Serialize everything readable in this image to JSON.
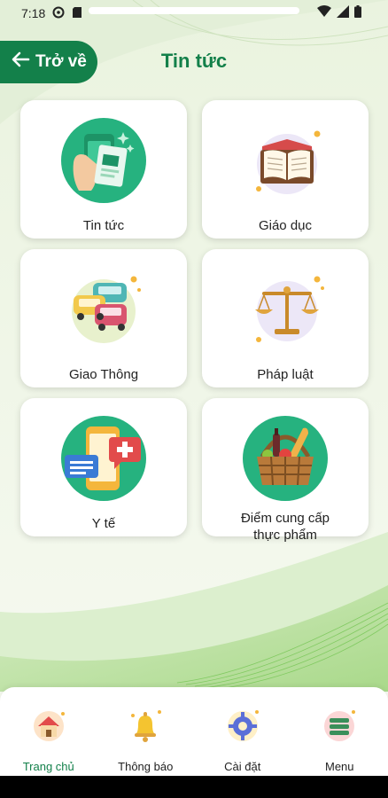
{
  "status_bar": {
    "time": "7:18"
  },
  "header": {
    "back_label": "Trở về",
    "title": "Tin tức"
  },
  "categories": [
    {
      "label": "Tin tức",
      "icon": "news-phone-icon"
    },
    {
      "label": "Giáo dục",
      "icon": "book-icon"
    },
    {
      "label": "Giao Thông",
      "icon": "traffic-cars-icon"
    },
    {
      "label": "Pháp luật",
      "icon": "scales-icon"
    },
    {
      "label": "Y tế",
      "icon": "health-phone-icon"
    },
    {
      "label_line1": "Điểm cung cấp",
      "label_line2": "thực phẩm",
      "icon": "food-basket-icon"
    }
  ],
  "bottom_nav": [
    {
      "label": "Trang chủ",
      "icon": "home-icon",
      "active": true
    },
    {
      "label": "Thông báo",
      "icon": "bell-icon",
      "active": false
    },
    {
      "label": "Cài đặt",
      "icon": "settings-gear-icon",
      "active": false
    },
    {
      "label": "Menu",
      "icon": "menu-icon",
      "active": false
    }
  ],
  "colors": {
    "primary": "#13804a",
    "background": "#f4f7f0"
  }
}
